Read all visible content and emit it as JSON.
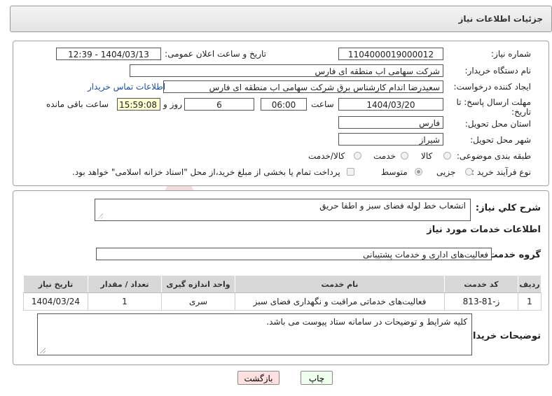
{
  "header": {
    "title": "جزئیات اطلاعات نیاز"
  },
  "form": {
    "need_number": {
      "label": "شماره نیاز:",
      "value": "1104000019000012"
    },
    "announce_datetime": {
      "label": "تاریخ و ساعت اعلان عمومی:",
      "value": "1404/03/13 - 12:39"
    },
    "buyer_org": {
      "label": "نام دستگاه خریدار:",
      "value": "شرکت سهامی اب منطقه ای فارس"
    },
    "requester": {
      "label": "ایجاد کننده درخواست:",
      "value": "سعیدرضا اندام کارشناس برق شرکت سهامی اب منطقه ای فارس",
      "contact_link": "اطلاعات تماس خریدار"
    },
    "deadline": {
      "label_line1": "مهلت ارسال پاسخ: تا",
      "label_line2": "تاریخ:",
      "date": "1404/03/20",
      "time_label": "ساعت",
      "time": "06:00",
      "days": "6",
      "days_label": "روز و",
      "remaining": "15:59:08",
      "remaining_label": "ساعت باقی مانده"
    },
    "province": {
      "label": "استان محل تحویل:",
      "value": "فارس"
    },
    "city": {
      "label": "شهر محل تحویل:",
      "value": "شیراز"
    },
    "category": {
      "label": "طبقه بندی موضوعی:",
      "options": [
        "کالا",
        "خدمت",
        "کالا/خدمت"
      ]
    },
    "purchase_type": {
      "label": "نوع فرآیند خرید :",
      "options": [
        "جزیی",
        "متوسط"
      ],
      "treasury_note": "پرداخت تمام یا بخشی از مبلغ خرید،از محل \"اسناد خزانه اسلامی\" خواهد بود."
    }
  },
  "description": {
    "label": "شرح کلي نياز:",
    "value": "انشعاب خط لوله فضای سبز و اطفا حریق"
  },
  "services": {
    "section_title": "اطلاعات خدمات مورد نیاز",
    "group_label": "گروه خدمت:",
    "group_value": "فعالیت‌های اداری و خدمات پشتیبانی",
    "columns": [
      "ردیف",
      "کد خدمت",
      "نام خدمت",
      "واحد اندازه گیری",
      "تعداد / مقدار",
      "تاریخ نیاز"
    ],
    "rows": [
      [
        "1",
        "ز-81-813",
        "فعالیت‌های خدماتی مراقبت و نگهداری فضای سبز",
        "سری",
        "1",
        "1404/03/24"
      ]
    ]
  },
  "buyer_notes": {
    "label": "توضیحات خریدار:",
    "value": "کلیه شرایط و توضیحات در سامانه ستاد پیوست می باشد."
  },
  "buttons": {
    "print": "چاپ",
    "back": "بازگشت"
  },
  "watermark": {
    "text": "AriaTender.net",
    "color": "#e8a8a8"
  },
  "colors": {
    "link": "#1a4fa0",
    "highlight": "#ffffd2",
    "back_button": "#ffe0e0",
    "print_button": "#eeffee"
  }
}
